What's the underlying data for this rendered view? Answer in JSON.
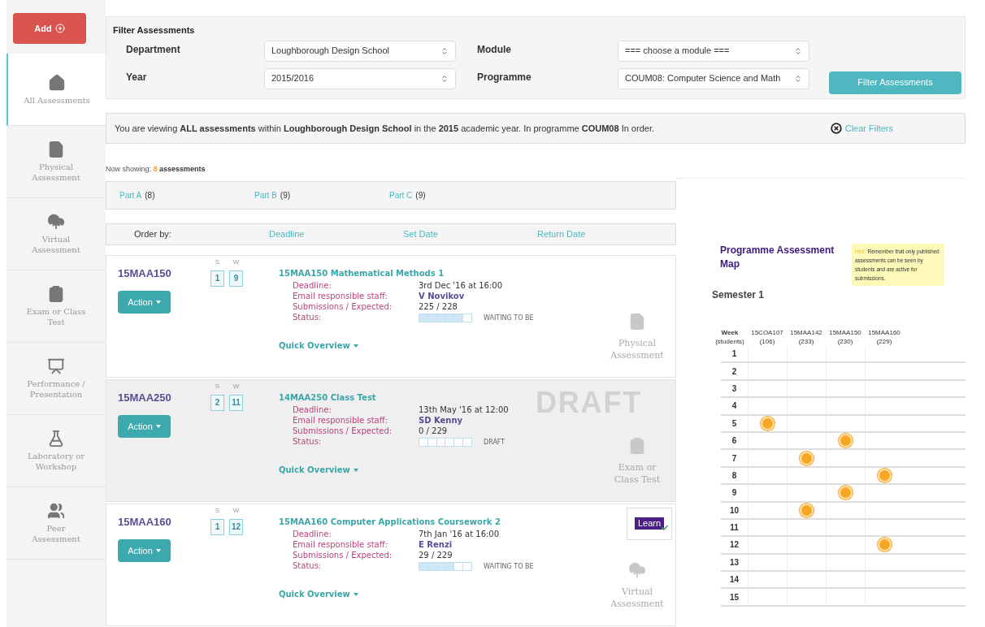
{
  "sidebar": {
    "add_button": "Add",
    "items": [
      {
        "kind": "home",
        "label": "All Assessments",
        "selected": true
      },
      {
        "kind": "file",
        "label": "Physical Assessment",
        "selected": false
      },
      {
        "kind": "cloud",
        "label": "Virtual Assessment",
        "selected": false
      },
      {
        "kind": "clipboard",
        "label": "Exam or Class Test",
        "selected": false
      },
      {
        "kind": "presentation",
        "label": "Performance / Presentation",
        "selected": false
      },
      {
        "kind": "flask",
        "label": "Laboratory or Workshop",
        "selected": false
      },
      {
        "kind": "users",
        "label": "Peer Assessment",
        "selected": false
      }
    ]
  },
  "filter": {
    "title": "Filter Assessments",
    "fields": [
      {
        "label": "Department",
        "value": "Loughborough Design School"
      },
      {
        "label": "Module",
        "value": "=== choose a module ==="
      },
      {
        "label": "Year",
        "value": "2015/2016"
      },
      {
        "label": "Programme",
        "value": "COUM08: Computer Science and Math"
      }
    ],
    "button": "Filter Assessments"
  },
  "info_bar": {
    "text": "You are viewing **ALL assessments** within **Loughborough Design School** in the **2015** academic year. In programme **COUM08** In order.",
    "clear": "Clear Filters"
  },
  "now_showing": {
    "label": "Now showing:",
    "count": "8",
    "suffix": "assessments"
  },
  "parts": [
    {
      "label": "Part A",
      "count": "(8)"
    },
    {
      "label": "Part B",
      "count": "(9)"
    },
    {
      "label": "Part C",
      "count": "(9)"
    }
  ],
  "order_by": {
    "label": "Order by:",
    "options": [
      "Deadline",
      "Set Date",
      "Return Date"
    ]
  },
  "assessments": [
    {
      "code": "15MAA150",
      "action": "Action",
      "s": "1",
      "w": "9",
      "title": "15MAA150 Mathematical Methods 1",
      "deadline": "3rd Dec '16 at 16:00",
      "staff": "V Novikov",
      "submissions": "225 / 228",
      "level": 0.83,
      "status": "WAITING TO BE",
      "quick": "Quick Overview",
      "kind": "physical",
      "kind_label": "Physical Assessment",
      "draft": false,
      "labels": {
        "deadline": "Deadline:",
        "staff": "Email responsible staff:",
        "submissions": "Submissions / Expected:",
        "status": "Status:",
        "s": "S",
        "w": "W"
      }
    },
    {
      "code": "15MAA250",
      "action": "Action",
      "s": "2",
      "w": "11",
      "title": "14MAA250 Class Test",
      "deadline": "13th May '16 at 12:00",
      "staff": "SD Kenny",
      "submissions": "0 / 229",
      "level": 0,
      "status": "DRAFT",
      "quick": "Quick Overview",
      "kind": "exam",
      "kind_label": "Exam or Class Test",
      "draft": true,
      "stamp": "DRAFT",
      "labels": {
        "deadline": "Deadline:",
        "staff": "Email responsible staff:",
        "submissions": "Submissions / Expected:",
        "status": "Status:",
        "s": "S",
        "w": "W"
      }
    },
    {
      "code": "15MAA160",
      "action": "Action",
      "s": "1",
      "w": "12",
      "title": "15MAA160 Computer Applications Coursework 2",
      "deadline": "7th Jan '16 at 16:00",
      "staff": "E Renzi",
      "submissions": "29 / 229",
      "level": 0.67,
      "status": "WAITING TO BE",
      "quick": "Quick Overview",
      "kind": "virtual",
      "kind_label": "Virtual Assessment",
      "draft": false,
      "badge": "Learn",
      "labels": {
        "deadline": "Deadline:",
        "staff": "Email responsible staff:",
        "submissions": "Submissions / Expected:",
        "status": "Status:",
        "s": "S",
        "w": "W"
      }
    }
  ],
  "map": {
    "title": "Programme Assessment Map",
    "hint_label": "Hint",
    "hint": "Remember that only published assessments can be seen by students and are active for submissions.",
    "semester": "Semester 1",
    "columns": [
      {
        "name": "Week",
        "sub": "(students)"
      },
      {
        "name": "15COA107",
        "sub": "(106)"
      },
      {
        "name": "15MAA142",
        "sub": "(233)"
      },
      {
        "name": "15MAA150",
        "sub": "(230)"
      },
      {
        "name": "15MAA160",
        "sub": "(229)"
      }
    ],
    "rows": [
      {
        "week": "1",
        "marks": [
          false,
          false,
          false,
          false
        ]
      },
      {
        "week": "2",
        "marks": [
          false,
          false,
          false,
          false
        ]
      },
      {
        "week": "3",
        "marks": [
          false,
          false,
          false,
          false
        ]
      },
      {
        "week": "4",
        "marks": [
          false,
          false,
          false,
          false
        ]
      },
      {
        "week": "5",
        "marks": [
          true,
          false,
          false,
          false
        ]
      },
      {
        "week": "6",
        "marks": [
          false,
          false,
          true,
          false
        ]
      },
      {
        "week": "7",
        "marks": [
          false,
          true,
          false,
          false
        ]
      },
      {
        "week": "8",
        "marks": [
          false,
          false,
          false,
          true
        ]
      },
      {
        "week": "9",
        "marks": [
          false,
          false,
          true,
          false
        ]
      },
      {
        "week": "10",
        "marks": [
          false,
          true,
          false,
          false
        ]
      },
      {
        "week": "11",
        "marks": [
          false,
          false,
          false,
          false
        ]
      },
      {
        "week": "12",
        "marks": [
          false,
          false,
          false,
          true
        ]
      },
      {
        "week": "13",
        "marks": [
          false,
          false,
          false,
          false
        ]
      },
      {
        "week": "14",
        "marks": [
          false,
          false,
          false,
          false
        ]
      },
      {
        "week": "15",
        "marks": [
          false,
          false,
          false,
          false
        ]
      }
    ]
  }
}
